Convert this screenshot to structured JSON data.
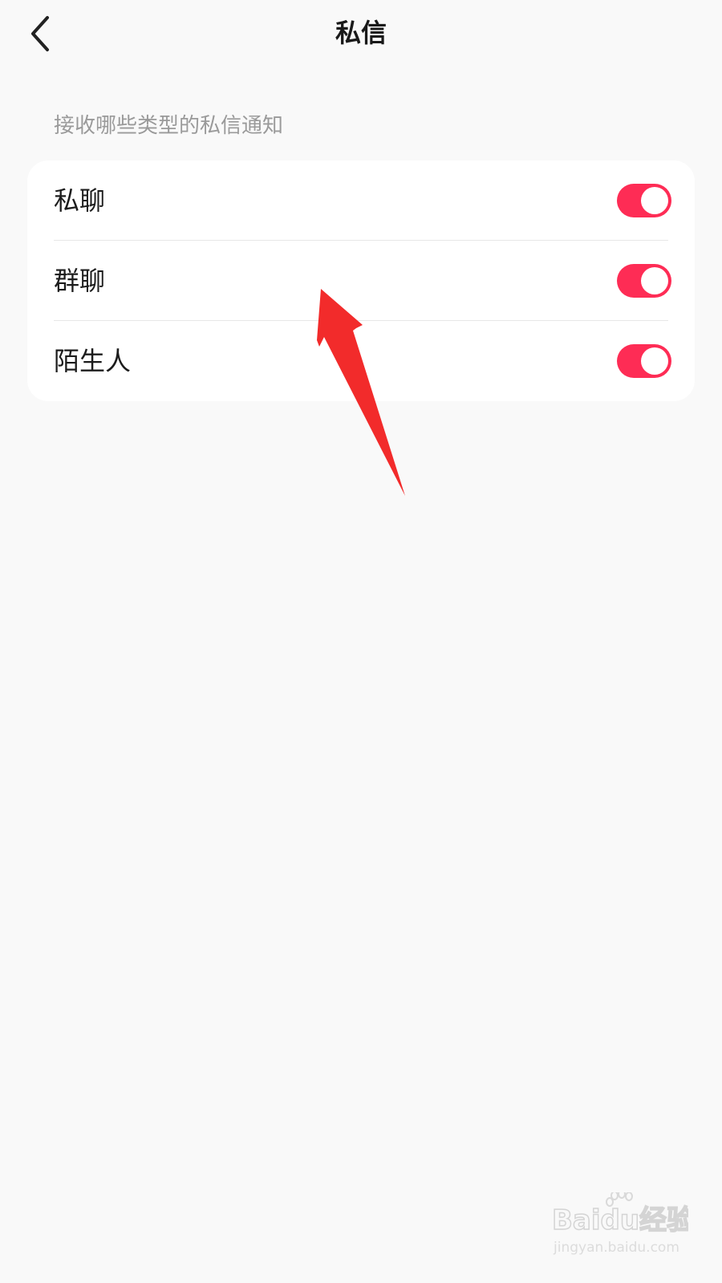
{
  "header": {
    "title": "私信",
    "back_icon": "chevron-left-icon"
  },
  "section": {
    "header": "接收哪些类型的私信通知"
  },
  "settings": [
    {
      "label": "私聊",
      "enabled": true
    },
    {
      "label": "群聊",
      "enabled": true
    },
    {
      "label": "陌生人",
      "enabled": true
    }
  ],
  "colors": {
    "accent": "#fe2c55",
    "annotation_arrow": "#f22b2b",
    "background": "#f9f9f9",
    "card": "#ffffff"
  },
  "watermark": {
    "brand": "Baidu经验",
    "url": "jingyan.baidu.com"
  }
}
